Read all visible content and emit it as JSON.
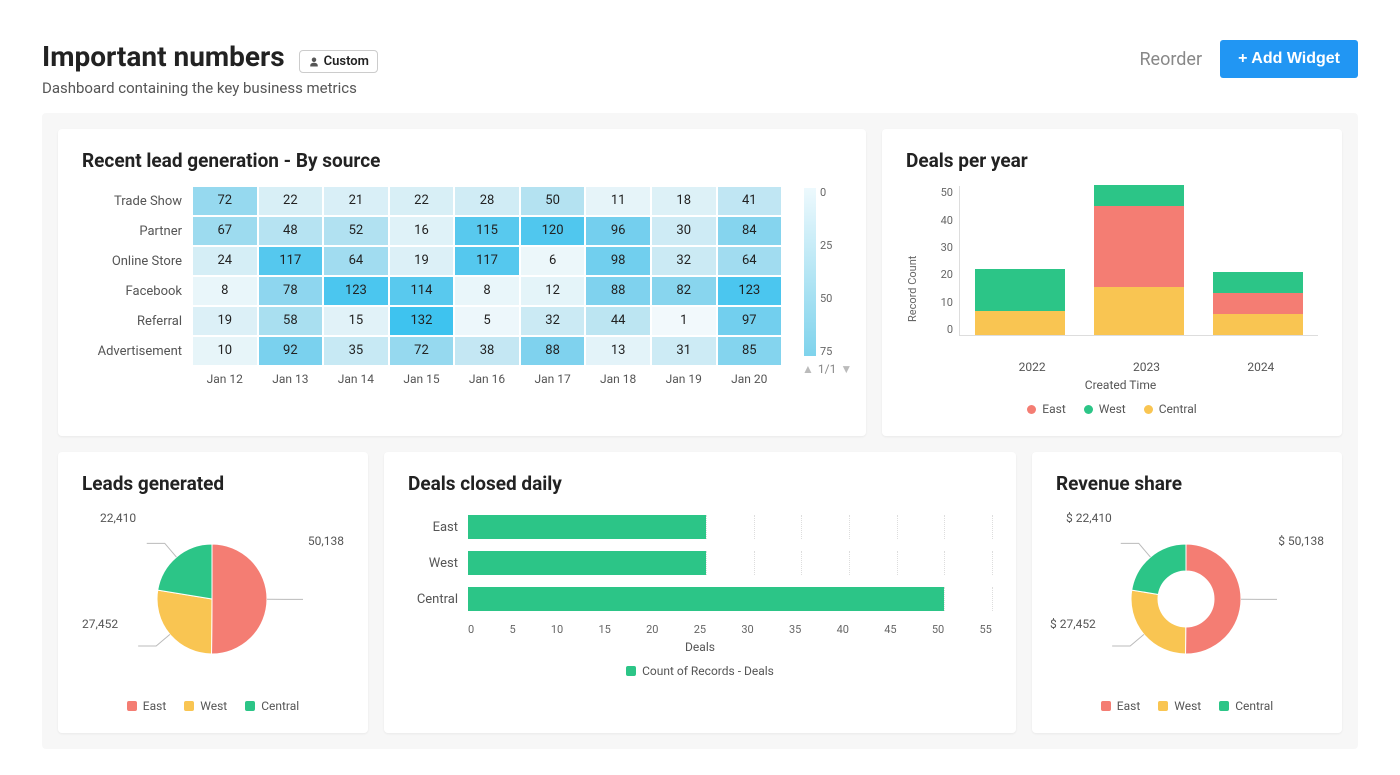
{
  "header": {
    "title": "Important numbers",
    "badge": "Custom",
    "subtitle": "Dashboard containing the key business metrics",
    "reorder": "Reorder",
    "add_widget": "+ Add Widget"
  },
  "colors": {
    "east": "#f47d73",
    "west": "#f9c552",
    "central": "#2cc587",
    "blue": "#2196f3"
  },
  "heatmap": {
    "title": "Recent lead generation - By source",
    "legend_ticks": [
      "0",
      "25",
      "50",
      "75"
    ],
    "pager": "1/1"
  },
  "deals_year": {
    "title": "Deals per year",
    "ylabel": "Record Count",
    "xlabel": "Created Time"
  },
  "leads_pie": {
    "title": "Leads generated",
    "labels": {
      "east": "50,138",
      "west": "27,452",
      "central": "22,410"
    }
  },
  "deals_daily": {
    "title": "Deals closed daily",
    "xlabel": "Deals",
    "legend": "Count of Records - Deals"
  },
  "revenue": {
    "title": "Revenue share",
    "labels": {
      "east": "$ 50,138",
      "west": "$ 27,452",
      "central": "$ 22,410"
    }
  },
  "region_legend": {
    "east": "East",
    "west": "West",
    "central": "Central"
  },
  "chart_data": [
    {
      "id": "heatmap",
      "type": "heatmap",
      "title": "Recent lead generation - By source",
      "x_categories": [
        "Jan 12",
        "Jan 13",
        "Jan 14",
        "Jan 15",
        "Jan 16",
        "Jan 17",
        "Jan 18",
        "Jan 19",
        "Jan 20"
      ],
      "y_categories": [
        "Trade Show",
        "Partner",
        "Online Store",
        "Facebook",
        "Referral",
        "Advertisement"
      ],
      "values": [
        [
          72,
          22,
          21,
          22,
          28,
          50,
          11,
          18,
          41
        ],
        [
          67,
          48,
          52,
          16,
          115,
          120,
          96,
          30,
          84
        ],
        [
          24,
          117,
          64,
          19,
          117,
          6,
          98,
          32,
          64
        ],
        [
          8,
          78,
          123,
          114,
          8,
          12,
          88,
          82,
          123
        ],
        [
          19,
          58,
          15,
          132,
          5,
          32,
          44,
          1,
          97
        ],
        [
          10,
          92,
          35,
          72,
          38,
          88,
          13,
          31,
          85
        ]
      ],
      "color_scale_ticks": [
        0,
        25,
        50,
        75
      ]
    },
    {
      "id": "deals_per_year",
      "type": "bar",
      "stacked": true,
      "title": "Deals per year",
      "xlabel": "Created Time",
      "ylabel": "Record Count",
      "categories": [
        "2022",
        "2023",
        "2024"
      ],
      "series": [
        {
          "name": "East",
          "values": [
            0,
            27,
            7
          ]
        },
        {
          "name": "West",
          "values": [
            14,
            7,
            7
          ]
        },
        {
          "name": "Central",
          "values": [
            8,
            16,
            7
          ]
        }
      ],
      "ylim": [
        0,
        50
      ]
    },
    {
      "id": "leads_generated",
      "type": "pie",
      "title": "Leads generated",
      "categories": [
        "East",
        "West",
        "Central"
      ],
      "values": [
        50138,
        27452,
        22410
      ]
    },
    {
      "id": "deals_closed_daily",
      "type": "bar",
      "orientation": "horizontal",
      "title": "Deals closed daily",
      "xlabel": "Deals",
      "categories": [
        "East",
        "West",
        "Central"
      ],
      "values": [
        25,
        25,
        50
      ],
      "xlim": [
        0,
        55
      ],
      "x_ticks": [
        0,
        5,
        10,
        15,
        20,
        25,
        30,
        35,
        40,
        45,
        50,
        55
      ]
    },
    {
      "id": "revenue_share",
      "type": "pie",
      "donut": true,
      "title": "Revenue share",
      "categories": [
        "East",
        "West",
        "Central"
      ],
      "values": [
        50138,
        27452,
        22410
      ]
    }
  ]
}
